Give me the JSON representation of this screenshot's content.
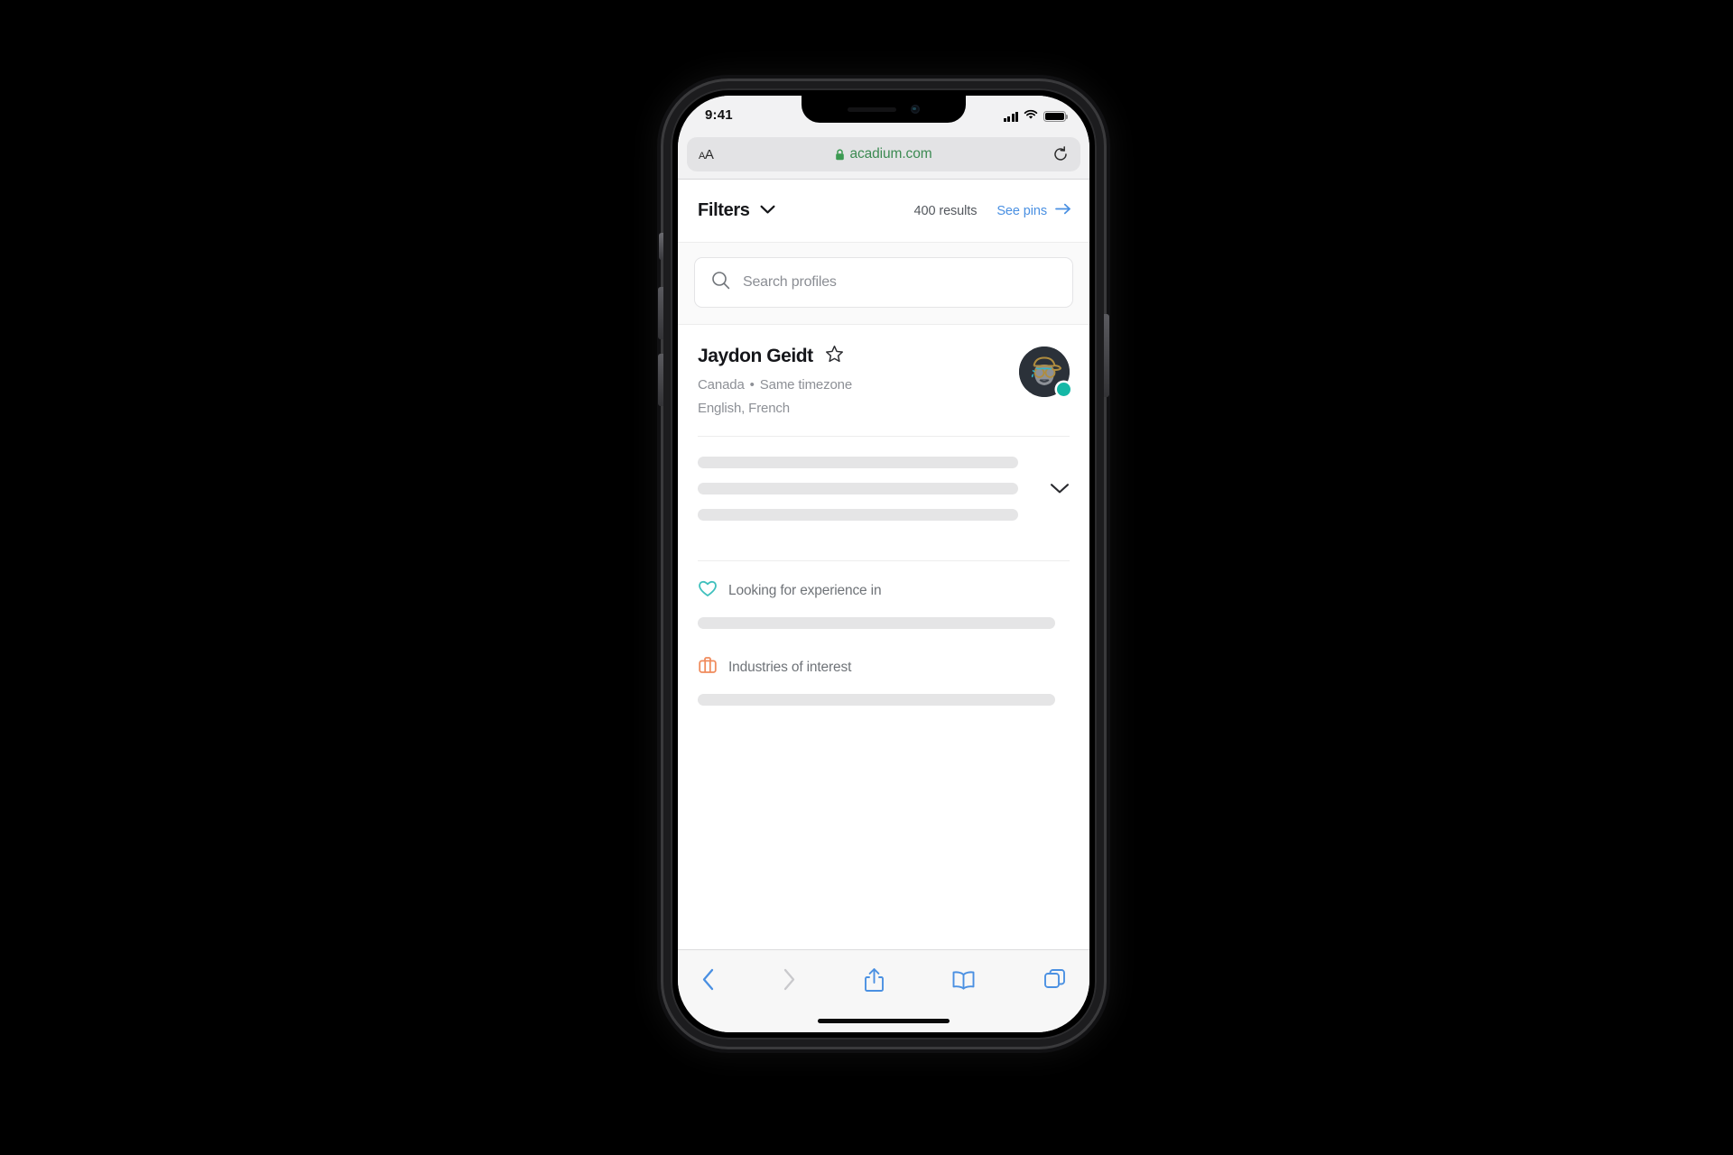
{
  "device": {
    "status_bar": {
      "time": "9:41",
      "icons": [
        "cellular-signal-icon",
        "wifi-icon",
        "battery-icon"
      ]
    },
    "home_indicator": "home-indicator"
  },
  "browser": {
    "text_size_button": "AA",
    "url": "acadium.com",
    "secure_icon": "lock-icon",
    "reload_icon": "reload-icon",
    "url_color": "#3c8a52",
    "toolbar": [
      {
        "name": "back-button",
        "icon": "chevron-left-icon",
        "enabled": true
      },
      {
        "name": "forward-button",
        "icon": "chevron-right-icon",
        "enabled": false
      },
      {
        "name": "share-button",
        "icon": "share-icon",
        "enabled": true
      },
      {
        "name": "bookmarks-button",
        "icon": "book-icon",
        "enabled": true
      },
      {
        "name": "tabs-button",
        "icon": "tabs-icon",
        "enabled": true
      }
    ],
    "accent_color": "#4a90e2"
  },
  "page": {
    "header": {
      "filters_label": "Filters",
      "filters_chevron": "chevron-down-icon",
      "results_count": "400 results",
      "see_pins_label": "See pins",
      "see_pins_arrow": "arrow-right-icon",
      "see_pins_color": "#4a90e2"
    },
    "search": {
      "placeholder": "Search profiles",
      "icon": "search-icon",
      "value": ""
    },
    "profile": {
      "name": "Jaydon Geidt",
      "favorite_icon": "star-outline-icon",
      "location": "Canada",
      "separator": "•",
      "timezone": "Same timezone",
      "languages": "English, French",
      "avatar": "avatar",
      "online_status_color": "#15b8a6",
      "expand_icon": "chevron-down-icon",
      "bio_placeholder_lines": 3,
      "sections": [
        {
          "title": "Looking for experience in",
          "icon": "heart-icon",
          "icon_color": "#3fc0bd",
          "placeholder_lines": 1
        },
        {
          "title": "Industries of interest",
          "icon": "briefcase-icon",
          "icon_color": "#f08b5c",
          "placeholder_lines": 1
        }
      ]
    }
  }
}
